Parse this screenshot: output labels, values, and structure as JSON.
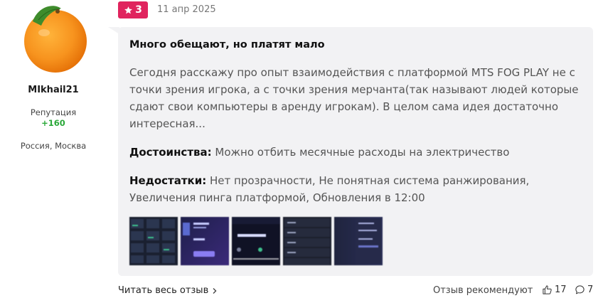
{
  "author": {
    "username": "MIkhail21",
    "reputation_label": "Репутация",
    "reputation_value": "+160",
    "location": "Россия, Москва"
  },
  "review": {
    "rating": "3",
    "date": "11 апр 2025",
    "title": "Много обещают, но платят мало",
    "text": "Сегодня расскажу про опыт взаимодействия с платформой MTS FOG PLAY не с точки зрения игрока, а с точки зрения мерчанта(так называют людей которые сдают свои компьютеры в аренду игрокам). В целом сама идея достаточно интересная...",
    "pros_label": "Достоинства:",
    "pros": "Можно отбить месячные расходы на электричество",
    "cons_label": "Недостатки:",
    "cons": "Нет прозрачности, Не понятная система ранжирования, Увеличения пинга платформой, Обновления в 12:00",
    "thumbnails": [
      "screenshot-1",
      "screenshot-2",
      "screenshot-3",
      "screenshot-4",
      "screenshot-5"
    ]
  },
  "footer": {
    "read_more": "Читать весь отзыв",
    "recommend_label": "Отзыв рекомендуют",
    "likes": "17",
    "comments": "7"
  },
  "colors": {
    "rating_badge": "#e0245e",
    "reputation": "#2aa839",
    "bubble": "#f2f2f4"
  }
}
